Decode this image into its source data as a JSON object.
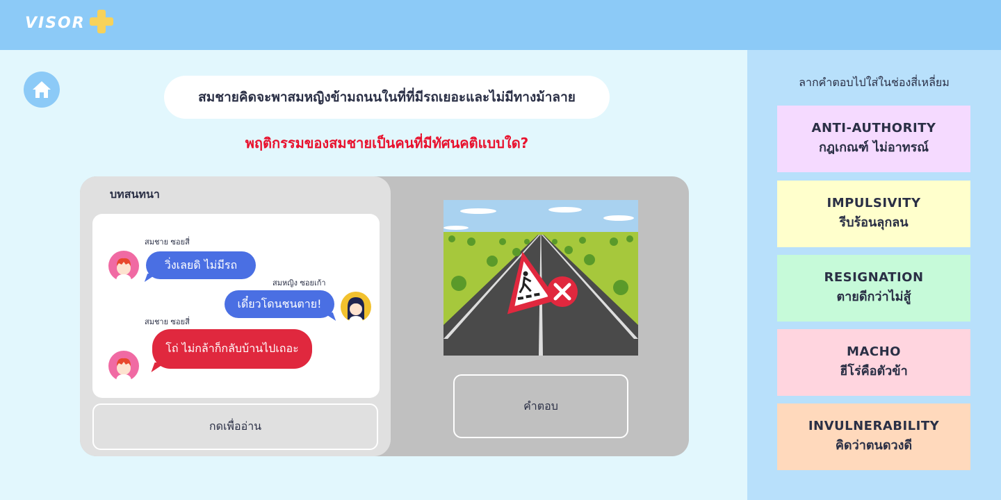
{
  "header": {
    "logo_text": "VISOR"
  },
  "scenario": {
    "text": "สมชายคิดจะพาสมหญิงข้ามถนนในที่ที่มีรถเยอะและไม่มีทางม้าลาย"
  },
  "question": {
    "text": "พฤติกรรมของสมชายเป็นคนที่มีทัศนคติแบบใด?"
  },
  "dialog": {
    "title": "บทสนทนา",
    "messages": [
      {
        "sender": "สมชาย ซอยสี่",
        "text": "วิ่งเลยดิ ไม่มีรถ",
        "color": "#4a6fe3"
      },
      {
        "sender": "สมหญิง ซอยเก้า",
        "text": "เดี๋ยวโดนชนตาย!",
        "color": "#4a6fe3"
      },
      {
        "sender": "สมชาย ซอยสี่",
        "text": "โถ่ ไม่กล้าก็กลับบ้านไปเถอะ",
        "color": "#e0283e"
      }
    ],
    "read_button": "กดเพื่ออ่าน"
  },
  "answer": {
    "placeholder": "คำตอบ"
  },
  "sidebar": {
    "instruction": "ลากคำตอบไปใส่ในช่องสี่เหลี่ยม",
    "cards": [
      {
        "en": "ANTI-AUTHORITY",
        "th": "กฎเกณฑ์ ไม่อาทรณ์",
        "color": "#f5daff"
      },
      {
        "en": "IMPULSIVITY",
        "th": "รีบร้อนลุกลน",
        "color": "#ffffcc"
      },
      {
        "en": "RESIGNATION",
        "th": "ตายดีกว่าไม่สู้",
        "color": "#c6fad9"
      },
      {
        "en": "MACHO",
        "th": "ฮีโร่คือตัวข้า",
        "color": "#ffd5df"
      },
      {
        "en": "INVULNERABILITY",
        "th": "คิดว่าตนดวงดี",
        "color": "#ffd9bc"
      }
    ]
  },
  "icons": {
    "home": "home-icon",
    "warning_sign": "pedestrian-crossing-sign-icon",
    "cross": "close-circle-icon"
  }
}
